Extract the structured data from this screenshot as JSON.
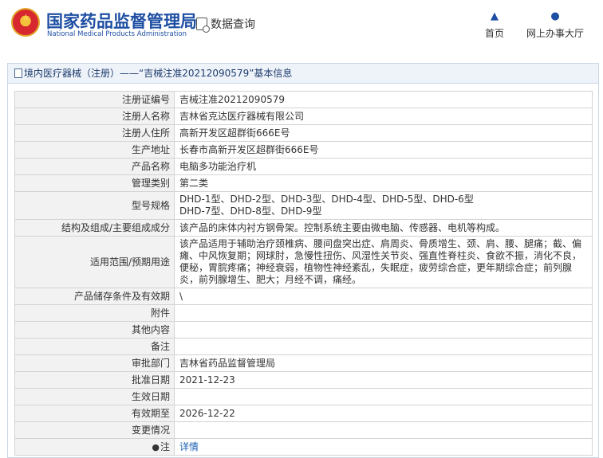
{
  "header": {
    "brand_cn": "国家药品监督管理局",
    "brand_en": "National Medical Products Administration",
    "query_label": "数据查询",
    "nav": {
      "home": "首页",
      "hall": "网上办事大厅"
    }
  },
  "panel": {
    "title": "境内医疗器械（注册）——“吉械注准20212090579”基本信息"
  },
  "rows": {
    "reg_no": {
      "label": "注册证编号",
      "value": "吉械注准20212090579"
    },
    "registrant": {
      "label": "注册人名称",
      "value": "吉林省克达医疗器械有限公司"
    },
    "address": {
      "label": "注册人住所",
      "value": "高新开发区超群街666E号"
    },
    "prod_address": {
      "label": "生产地址",
      "value": "长春市高新开发区超群街666E号"
    },
    "product_name": {
      "label": "产品名称",
      "value": "电脑多功能治疗机"
    },
    "category": {
      "label": "管理类别",
      "value": "第二类"
    },
    "models": {
      "label": "型号规格",
      "line1": "DHD-1型、DHD-2型、DHD-3型、DHD-4型、DHD-5型、DHD-6型",
      "line2": "DHD-7型、DHD-8型、DHD-9型"
    },
    "structure": {
      "label": "结构及组成/主要组成成分",
      "value": "该产品的床体内衬方钢骨架。控制系统主要由微电脑、传感器、电机等构成。"
    },
    "scope": {
      "label": "适用范围/预期用途",
      "line1": "该产品适用于辅助治疗颈椎病、腰间盘突出症、肩周炎、骨质增生、颈、肩、腰、腿痛；截、偏",
      "line2": "瘫、中风恢复期；网球肘，急慢性扭伤、风湿性关节炎、强直性脊柱炎、食欲不振，消化不良，",
      "line3": "便秘，胃脘疼痛；神经衰弱，植物性神经紊乱，失眠症，疲劳综合症，更年期综合症；前列腺",
      "line4": "炎，前列腺增生、肥大；月经不调，痛经。"
    },
    "storage": {
      "label": "产品储存条件及有效期",
      "value": "\\"
    },
    "attachment": {
      "label": "附件",
      "value": ""
    },
    "other": {
      "label": "其他内容",
      "value": ""
    },
    "remark": {
      "label": "备注",
      "value": ""
    },
    "dept": {
      "label": "审批部门",
      "value": "吉林省药品监督管理局"
    },
    "approve_date": {
      "label": "批准日期",
      "value": "2021-12-23"
    },
    "effect_date": {
      "label": "生效日期",
      "value": ""
    },
    "valid_until": {
      "label": "有效期至",
      "value": "2026-12-22"
    },
    "change": {
      "label": "变更情况",
      "value": ""
    },
    "note": {
      "label": "注",
      "value": "详情"
    }
  },
  "icons": {
    "logo": "national-emblem-icon",
    "query": "search-document-icon",
    "home": "home-icon",
    "hall": "user-icon",
    "title": "document-icon",
    "note": "notice-icon"
  },
  "colors": {
    "brand": "#1e4fa3",
    "link": "#1e5fb3",
    "label_bg": "#f2f2f2",
    "title_bg": "#eef3f9"
  }
}
